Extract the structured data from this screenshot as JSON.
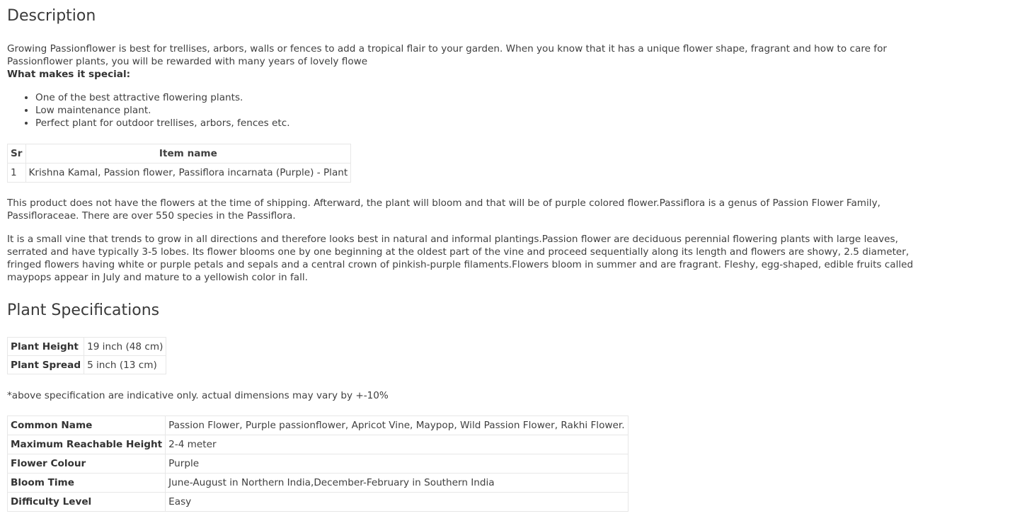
{
  "description": {
    "title": "Description",
    "intro": "Growing Passionflower is best for trellises, arbors, walls or fences to add a tropical flair to your garden. When you know that it has a unique flower shape, fragrant and how to care for Passionflower plants, you will be rewarded with many years of lovely flowe",
    "special_heading": "What makes it special:",
    "features": [
      "One of the best attractive flowering plants.",
      "Low maintenance plant.",
      "Perfect plant for outdoor trellises, arbors, fences etc."
    ],
    "item_table": {
      "headers": [
        "Sr",
        "Item name"
      ],
      "rows": [
        [
          "1",
          "Krishna Kamal, Passion flower, Passiflora incarnata (Purple) - Plant"
        ]
      ]
    },
    "paragraph1": "This product does not have the flowers at the time of shipping. Afterward, the plant will bloom and that will be of purple colored flower.Passiflora is a genus of Passion Flower Family, Passifloraceae. There are over 550 species in the Passiflora.",
    "paragraph2": "It is a small vine that trends to grow in all directions and therefore looks best in natural and informal plantings.Passion flower are deciduous perennial flowering plants with large leaves, serrated and have typically 3-5 lobes. Its flower blooms one by one beginning at the oldest part of the vine and proceed sequentially along its length and flowers are showy, 2.5 diameter, fringed flowers having white or purple petals and sepals and a central crown of pinkish-purple filaments.Flowers bloom in summer and are fragrant. Fleshy, egg-shaped, edible fruits called maypops appear in July and mature to a yellowish color in fall."
  },
  "specifications": {
    "title": "Plant Specifications",
    "size_rows": [
      {
        "label": "Plant Height",
        "value": "19 inch (48 cm)"
      },
      {
        "label": "Plant Spread",
        "value": "5 inch (13 cm)"
      }
    ],
    "note": "*above specification are indicative only. actual dimensions may vary by +-10%",
    "detail_rows": [
      {
        "label": "Common Name",
        "value": "Passion Flower, Purple passionflower, Apricot Vine, Maypop, Wild Passion Flower, Rakhi Flower."
      },
      {
        "label": "Maximum Reachable Height",
        "value": "2-4 meter"
      },
      {
        "label": "Flower Colour",
        "value": "Purple"
      },
      {
        "label": "Bloom Time",
        "value": "June-August in Northern India,December-February in Southern India"
      },
      {
        "label": "Difficulty Level",
        "value": "Easy"
      }
    ]
  }
}
